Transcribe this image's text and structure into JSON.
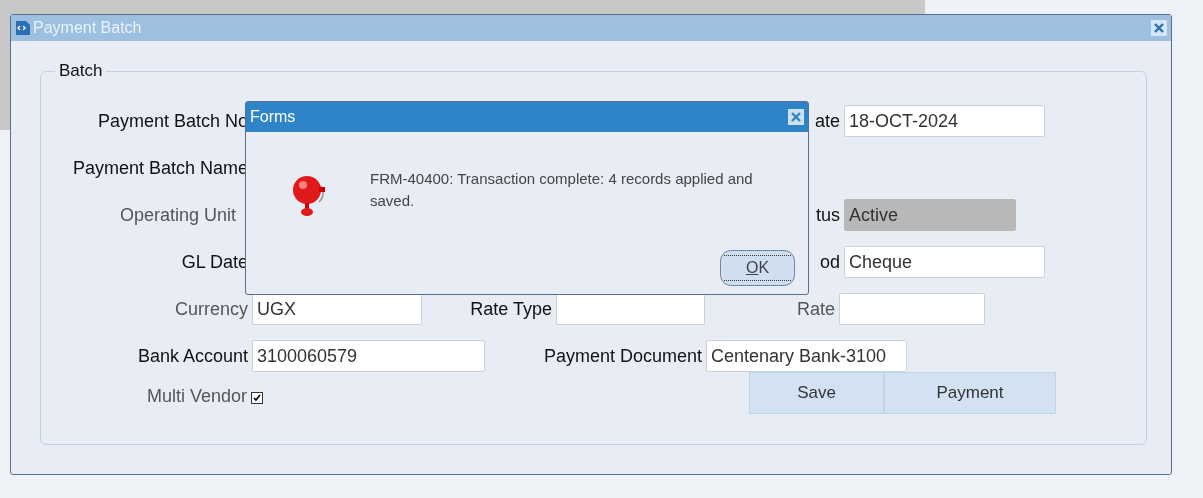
{
  "window": {
    "title": "Payment Batch"
  },
  "group": {
    "title": "Batch"
  },
  "fields": [
    {
      "label": "Payment Batch No",
      "required": true
    },
    {
      "label": "ate",
      "value": "18-OCT-2024",
      "required": true
    },
    {
      "label": "Payment Batch Name",
      "required": true
    },
    {
      "label": "Operating Unit",
      "required": false
    },
    {
      "label": "tus",
      "value": "Active",
      "required": true,
      "disabled": true
    },
    {
      "label": "GL Date",
      "required": true
    },
    {
      "label": "od",
      "value": "Cheque",
      "required": true,
      "disabled": false
    },
    {
      "label": "Currency",
      "value": "UGX",
      "required": false,
      "disabled": false
    },
    {
      "label": "Rate Type",
      "required": true,
      "disabled": false
    },
    {
      "label": "Rate",
      "required": false,
      "disabled": false
    },
    {
      "label": "Bank Account",
      "value": "3100060579",
      "required": true,
      "disabled": false
    },
    {
      "label": "Payment Document",
      "value": "Centenary Bank-3100",
      "required": true,
      "disabled": false
    }
  ],
  "multi_vendor": {
    "label": "Multi Vendor",
    "checked": true
  },
  "buttons": [
    {
      "label": "Save"
    },
    {
      "label": "Payment"
    }
  ],
  "dialog": {
    "title": "Forms",
    "message": "FRM-40400: Transaction complete: 4 records applied and saved.",
    "button": {
      "mnemonic": "O",
      "rest": "K"
    }
  }
}
